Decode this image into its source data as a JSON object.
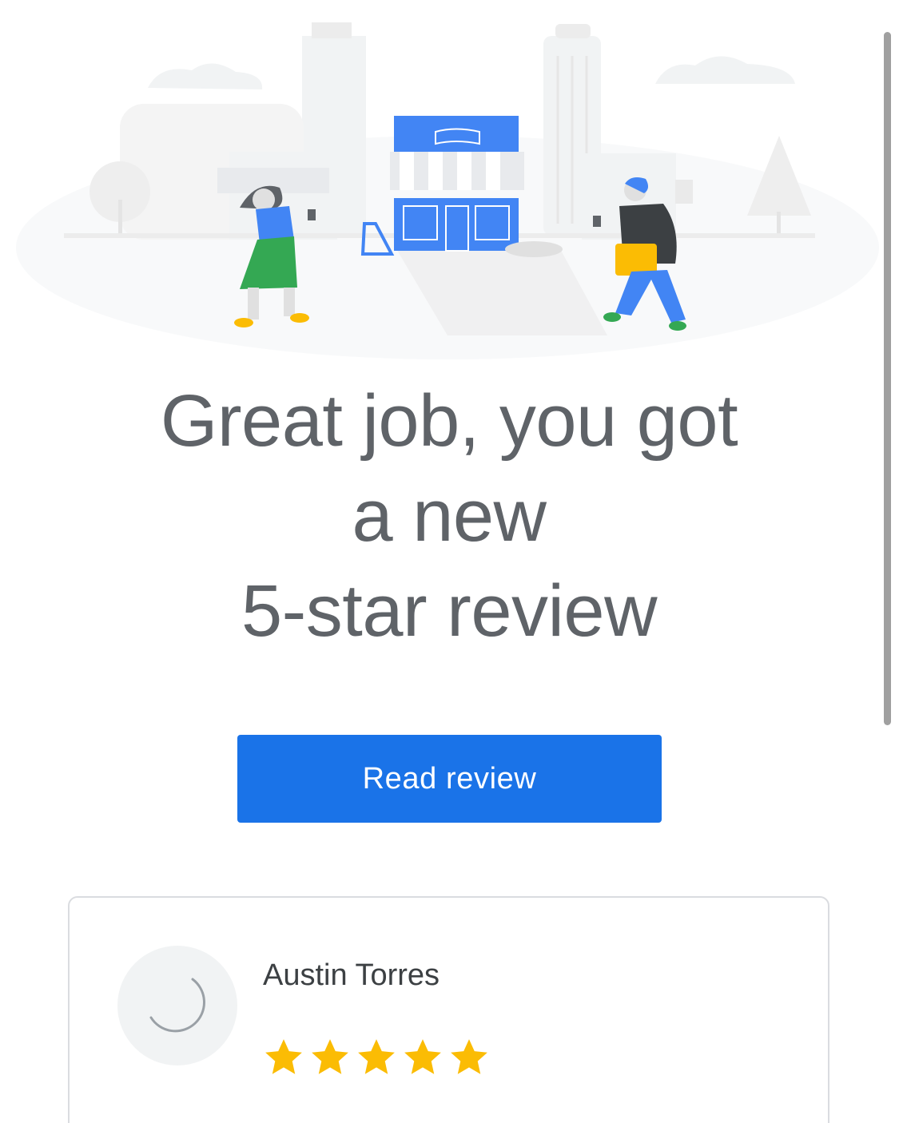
{
  "headline": {
    "line1": "Great job, you got",
    "line2": "a new",
    "line3": "5-star review"
  },
  "cta": {
    "label": "Read review"
  },
  "review": {
    "reviewer_name": "Austin Torres",
    "rating": 5,
    "max_rating": 5
  },
  "colors": {
    "primary_blue": "#1a73e8",
    "headline_gray": "#5f6368",
    "star_yellow": "#fbbc04",
    "card_border": "#dadce0"
  },
  "icons": {
    "avatar": "loading-spinner-icon",
    "rating": "star-icon"
  }
}
